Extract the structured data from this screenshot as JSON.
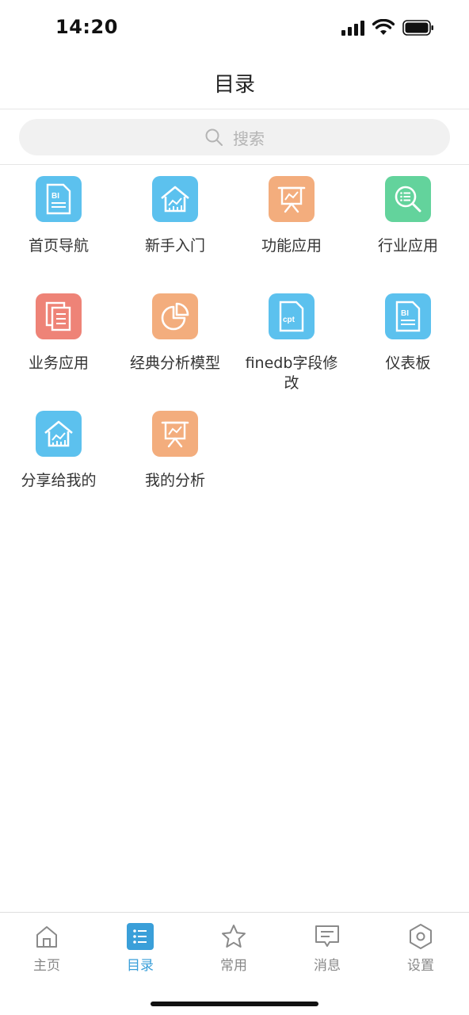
{
  "status_bar": {
    "time": "14:20"
  },
  "header": {
    "title": "目录"
  },
  "search": {
    "placeholder": "搜索"
  },
  "catalog": [
    {
      "label": "首页导航",
      "icon": "bi-report-icon",
      "color": "#5cc1ee"
    },
    {
      "label": "新手入门",
      "icon": "dashboard-home-icon",
      "color": "#5cc1ee"
    },
    {
      "label": "功能应用",
      "icon": "presentation-icon",
      "color": "#f3ad7d"
    },
    {
      "label": "行业应用",
      "icon": "search-list-icon",
      "color": "#63d39c"
    },
    {
      "label": "业务应用",
      "icon": "documents-icon",
      "color": "#ee8377"
    },
    {
      "label": "经典分析模型",
      "icon": "pie-chart-icon",
      "color": "#f3ad7d"
    },
    {
      "label": "finedb字段修改",
      "icon": "cpt-file-icon",
      "color": "#5cc1ee"
    },
    {
      "label": "仪表板",
      "icon": "bi-report-icon",
      "color": "#5cc1ee"
    },
    {
      "label": "分享给我的",
      "icon": "dashboard-home-icon",
      "color": "#5cc1ee"
    },
    {
      "label": "我的分析",
      "icon": "presentation-icon",
      "color": "#f3ad7d"
    }
  ],
  "tabs": [
    {
      "label": "主页",
      "icon": "home-icon",
      "active": false
    },
    {
      "label": "目录",
      "icon": "list-icon",
      "active": true
    },
    {
      "label": "常用",
      "icon": "star-icon",
      "active": false
    },
    {
      "label": "消息",
      "icon": "message-icon",
      "active": false
    },
    {
      "label": "设置",
      "icon": "settings-icon",
      "active": false
    }
  ],
  "colors": {
    "accent": "#3a9fd9",
    "blue_tile": "#5cc1ee",
    "orange_tile": "#f3ad7d",
    "green_tile": "#63d39c",
    "red_tile": "#ee8377"
  }
}
